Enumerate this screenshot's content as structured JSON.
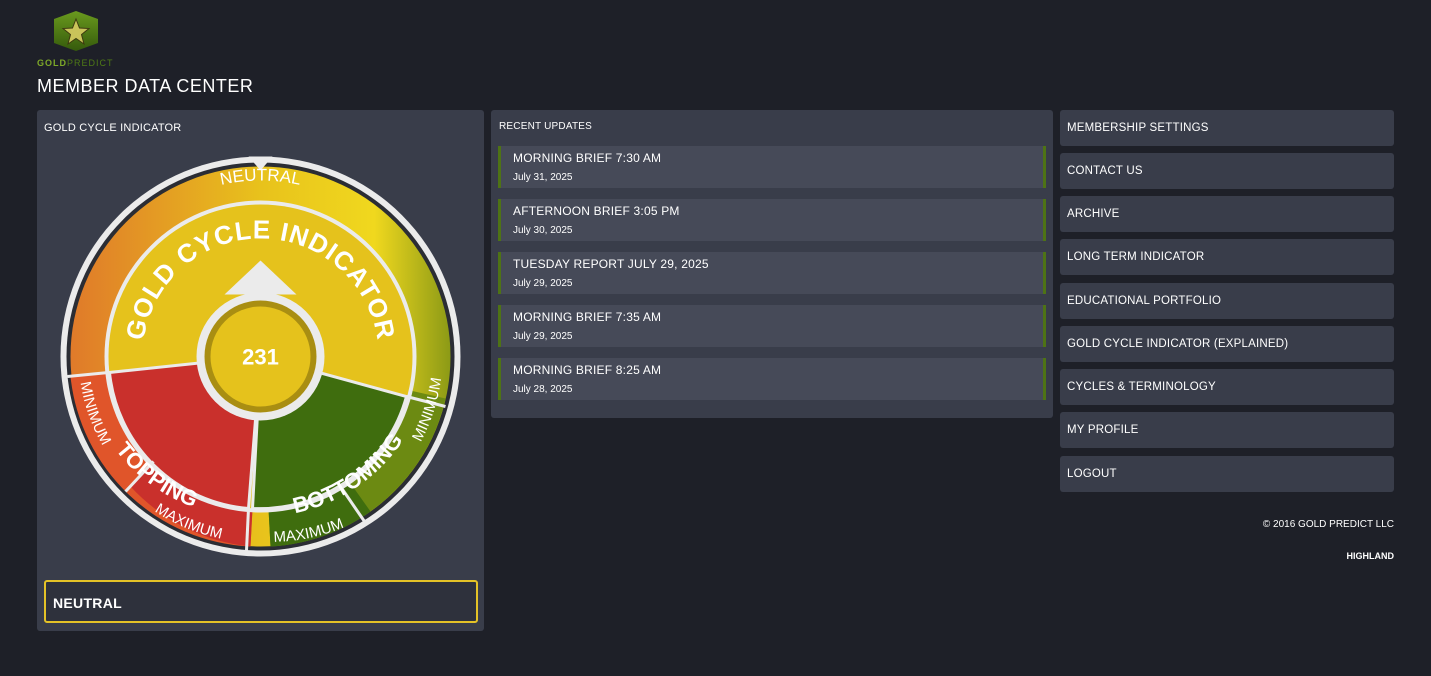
{
  "brand": {
    "part1": "GOLD",
    "part2": "PREDICT",
    "logo_icon": "star-hexagon-icon"
  },
  "page_title": "MEMBER DATA CENTER",
  "indicator_panel": {
    "title": "GOLD CYCLE INDICATOR",
    "dial": {
      "center_value": "231",
      "ring_title": "GOLD CYCLE INDICATOR",
      "top_label": "NEUTRAL",
      "left_segment": "TOPPING",
      "right_segment": "BOTTOMING",
      "minimum_label": "MINIMUM",
      "maximum_label": "MAXIMUM"
    },
    "status": "NEUTRAL"
  },
  "recent_updates": {
    "title": "RECENT UPDATES",
    "items": [
      {
        "title": "MORNING BRIEF 7:30 AM",
        "date": "July 31, 2025"
      },
      {
        "title": "AFTERNOON BRIEF 3:05 PM",
        "date": "July 30, 2025"
      },
      {
        "title": "TUESDAY REPORT JULY 29, 2025",
        "date": "July 29, 2025"
      },
      {
        "title": "MORNING BRIEF 7:35 AM",
        "date": "July 29, 2025"
      },
      {
        "title": "MORNING BRIEF 8:25 AM",
        "date": "July 28, 2025"
      }
    ]
  },
  "menu": {
    "items": [
      {
        "label": "MEMBERSHIP SETTINGS"
      },
      {
        "label": "CONTACT US"
      },
      {
        "label": "ARCHIVE"
      },
      {
        "label": "LONG TERM INDICATOR"
      },
      {
        "label": "EDUCATIONAL PORTFOLIO"
      },
      {
        "label": "GOLD CYCLE INDICATOR (EXPLAINED)"
      },
      {
        "label": "CYCLES & TERMINOLOGY"
      },
      {
        "label": "MY PROFILE"
      },
      {
        "label": "LOGOUT"
      }
    ]
  },
  "footer": {
    "copyright": "© 2016 GOLD PREDICT LLC",
    "credit": "HIGHLAND"
  },
  "colors": {
    "background": "#1e2028",
    "panel": "#393d4a",
    "accent_green": "#4e7315",
    "status_border": "#e4c227",
    "dial_yellow": "#e5c21c",
    "dial_red": "#c9302c",
    "dial_green": "#3f6d0e"
  }
}
